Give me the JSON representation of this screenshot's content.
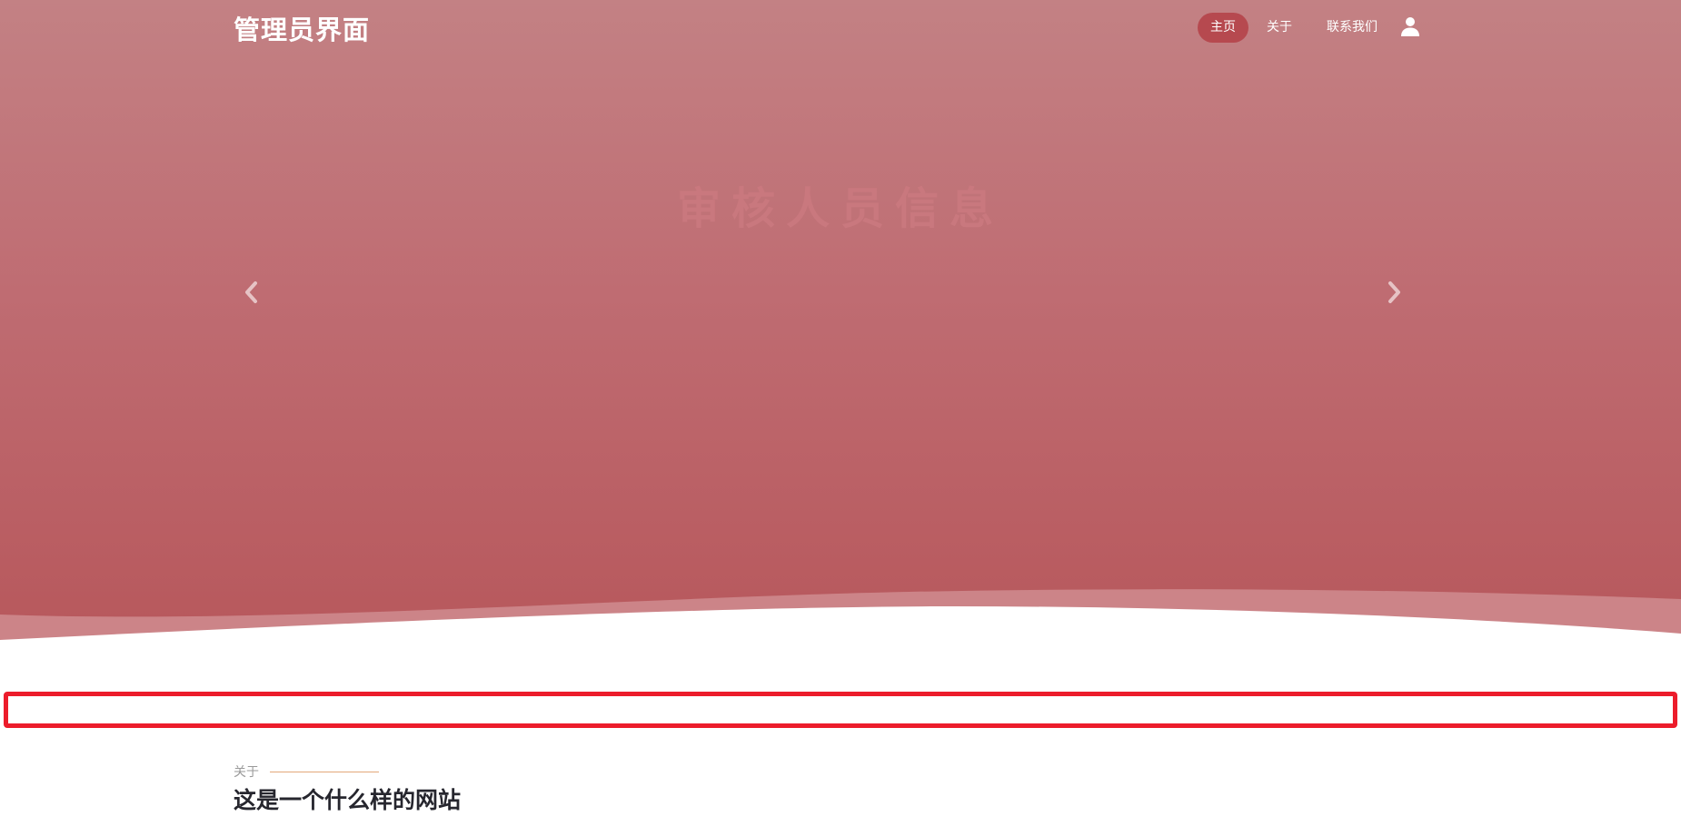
{
  "header": {
    "brand": "管理员界面",
    "nav": [
      {
        "label": "主页",
        "active": true
      },
      {
        "label": "关于",
        "active": false
      },
      {
        "label": "联系我们",
        "active": false
      }
    ],
    "user_icon": "user-icon"
  },
  "hero": {
    "title": "审核人员信息",
    "prev_icon": "chevron-left-icon",
    "next_icon": "chevron-right-icon"
  },
  "about": {
    "kicker": "关于",
    "heading": "这是一个什么样的网站"
  },
  "colors": {
    "hero_top": "#c38184",
    "hero_bottom": "#b7575b",
    "nav_active": "#b6494f",
    "highlight_border": "#ec1c2b",
    "kicker_line": "#e3a87a",
    "heading": "#26262e"
  }
}
